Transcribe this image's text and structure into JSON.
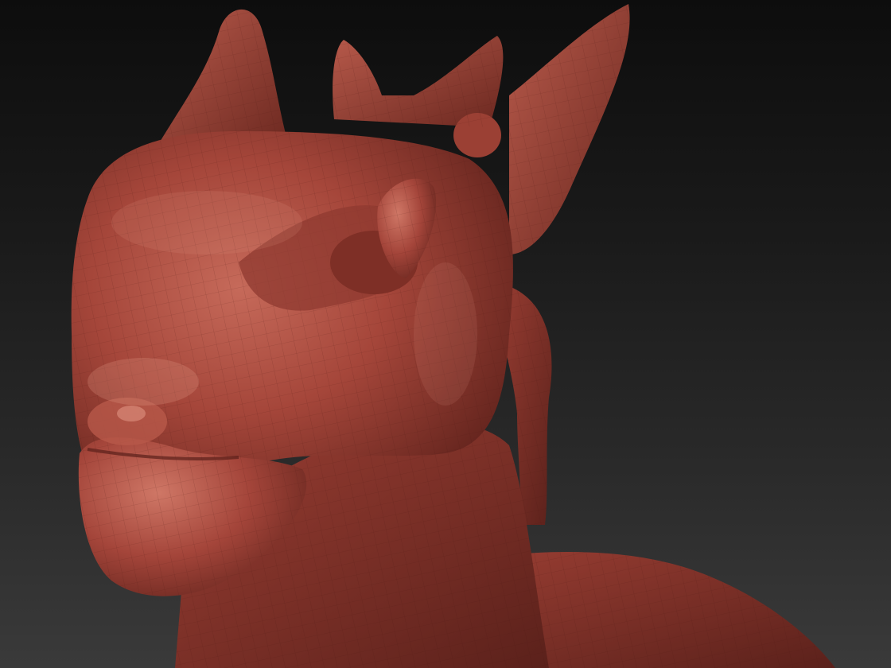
{
  "viewport": {
    "background_top": "#0d0d0d",
    "background_bottom": "#3a3a3a"
  },
  "model": {
    "subject": "dragon-head-sculpt",
    "material_color": "#a5463a",
    "highlight_color": "#d9806f",
    "shadow_color": "#5a1f19",
    "wireframe_visible": true
  }
}
